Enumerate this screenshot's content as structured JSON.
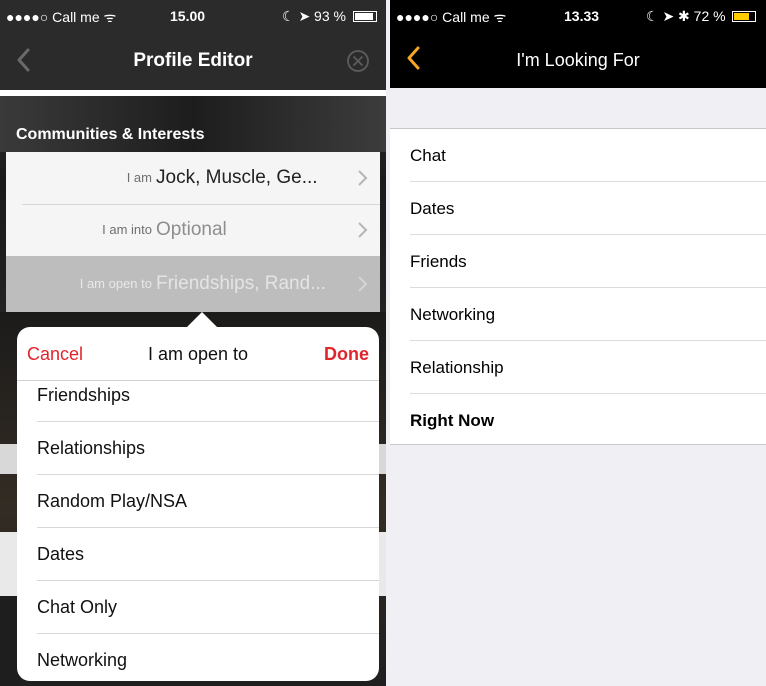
{
  "left": {
    "status": {
      "carrier": "●●●●○ Call me ᯤ",
      "time": "15.00",
      "indicators": "☾ ➤ 93 %",
      "battery_level": 0.93
    },
    "nav": {
      "title": "Profile Editor",
      "back_icon": "chevron-left-icon",
      "close_icon": "close-circle-icon"
    },
    "section_title": "Communities & Interests",
    "rows": [
      {
        "label": "I am",
        "value": "Jock, Muscle, Ge..."
      },
      {
        "label": "I am into",
        "value": "Optional"
      },
      {
        "label": "I am open to",
        "value": "Friendships, Rand..."
      }
    ],
    "popover": {
      "cancel": "Cancel",
      "title": "I am open to",
      "done": "Done",
      "options": [
        "Friendships",
        "Relationships",
        "Random Play/NSA",
        "Dates",
        "Chat Only",
        "Networking"
      ]
    }
  },
  "right": {
    "status": {
      "carrier": "●●●●○ Call me ᯤ",
      "time": "13.33",
      "indicators": "☾ ➤ ✱ 72 %",
      "battery_level": 0.72
    },
    "nav": {
      "title": "I'm Looking For",
      "back_icon": "chevron-left-icon"
    },
    "items": [
      "Chat",
      "Dates",
      "Friends",
      "Networking",
      "Relationship",
      "Right Now"
    ],
    "accent_color": "#f5a623"
  },
  "colors": {
    "destructive_red": "#e0252b",
    "bold_item": "Right Now"
  }
}
